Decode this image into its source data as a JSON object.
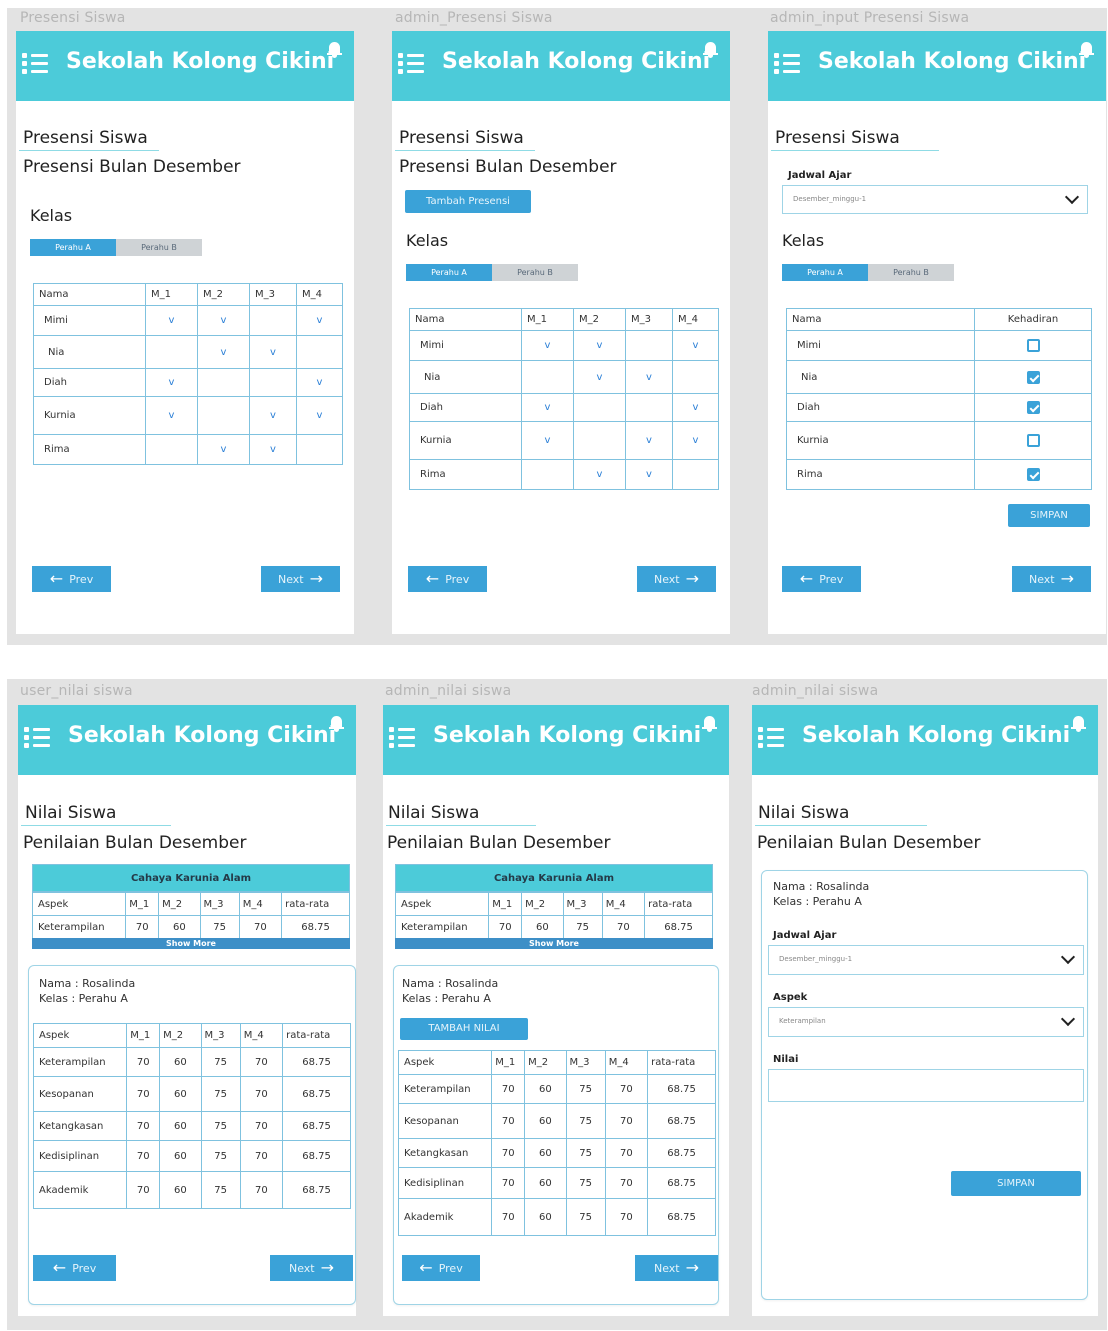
{
  "app_title": "Sekolah Kolong Cikini",
  "frames": {
    "f1": "Presensi Siswa",
    "f2": "admin_Presensi Siswa",
    "f3": "admin_input Presensi Siswa",
    "f4": "user_nilai siswa",
    "f5": "admin_nilai siswa",
    "f6": "admin_nilai siswa"
  },
  "presensi": {
    "title": "Presensi Siswa",
    "subtitle": "Presensi Bulan Desember",
    "kelas_label": "Kelas",
    "tab_a": "Perahu A",
    "tab_b": "Perahu B",
    "add_button": "Tambah Presensi",
    "jadwal_label": "Jadwal Ajar",
    "jadwal_value": "Desember_minggu-1",
    "save_button": "SIMPAN",
    "headers": [
      "Nama",
      "M_1",
      "M_2",
      "M_3",
      "M_4"
    ],
    "kehadiran_header": "Kehadiran",
    "check_mark": "v",
    "students": [
      "Mimi",
      "Nia",
      "Diah",
      "Kurnia",
      "Rima"
    ]
  },
  "attendance": [
    [
      true,
      true,
      false,
      true
    ],
    [
      false,
      true,
      true,
      false
    ],
    [
      true,
      false,
      false,
      true
    ],
    [
      true,
      false,
      true,
      true
    ],
    [
      false,
      true,
      true,
      false
    ]
  ],
  "kehadiran": [
    false,
    true,
    true,
    false,
    true
  ],
  "nav": {
    "prev": "Prev",
    "next": "Next"
  },
  "nilai": {
    "title": "Nilai Siswa",
    "subtitle": "Penilaian Bulan Desember",
    "card_title": "Cahaya Karunia Alam",
    "show_more": "Show More",
    "nama": "Nama : Rosalinda",
    "kelas": "Kelas : Perahu A",
    "add_button": "TAMBAH NILAI",
    "jadwal_label": "Jadwal Ajar",
    "jadwal_value": "Desember_minggu-1",
    "aspek_label": "Aspek",
    "aspek_value": "Keterampilan",
    "nilai_label": "Nilai",
    "save_button": "SIMPAN",
    "headers": [
      "Aspek",
      "M_1",
      "M_2",
      "M_3",
      "M_4",
      "rata-rata"
    ],
    "rows": [
      [
        "Keterampilan",
        "70",
        "60",
        "75",
        "70",
        "68.75"
      ],
      [
        "Kesopanan",
        "70",
        "60",
        "75",
        "70",
        "68.75"
      ],
      [
        "Ketangkasan",
        "70",
        "60",
        "75",
        "70",
        "68.75"
      ],
      [
        "Kedisiplinan",
        "70",
        "60",
        "75",
        "70",
        "68.75"
      ],
      [
        "Akademik",
        "70",
        "60",
        "75",
        "70",
        "68.75"
      ]
    ]
  }
}
